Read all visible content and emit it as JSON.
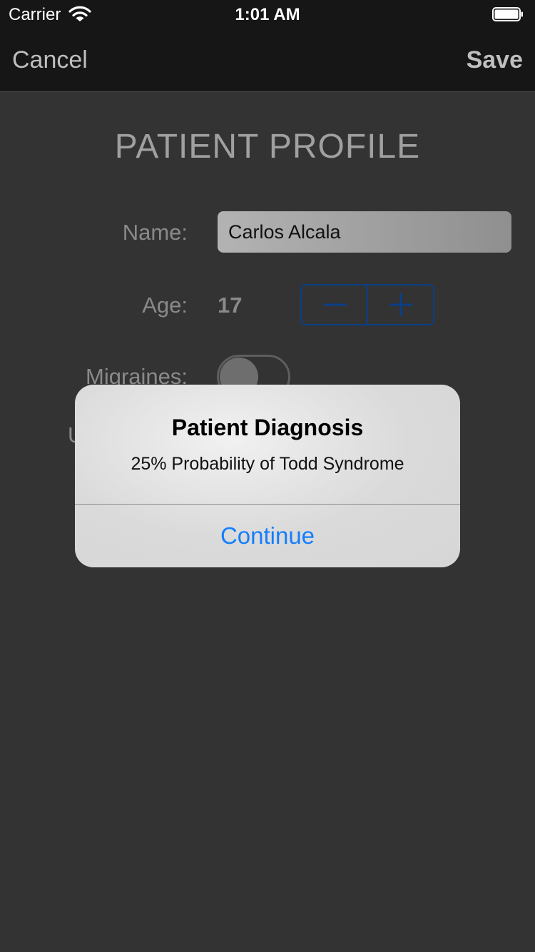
{
  "status_bar": {
    "carrier": "Carrier",
    "time": "1:01 AM"
  },
  "nav": {
    "cancel_label": "Cancel",
    "save_label": "Save"
  },
  "form": {
    "title": "PATIENT PROFILE",
    "name_label": "Name:",
    "name_value": "Carlos Alcala",
    "age_label": "Age:",
    "age_value": "17",
    "stepper_minus": "−",
    "stepper_plus": "+",
    "migraines_label": "Migraines:",
    "migraines_on": false,
    "hidden_label_fragment": "U"
  },
  "alert": {
    "title": "Patient Diagnosis",
    "message": "25% Probability of Todd Syndrome",
    "button_label": "Continue"
  },
  "colors": {
    "accent": "#147efb",
    "stepper_tint": "#0a3f88",
    "background": "#333333",
    "nav_background": "#161616"
  },
  "icons": {
    "wifi": "wifi-icon",
    "battery": "battery-icon"
  }
}
